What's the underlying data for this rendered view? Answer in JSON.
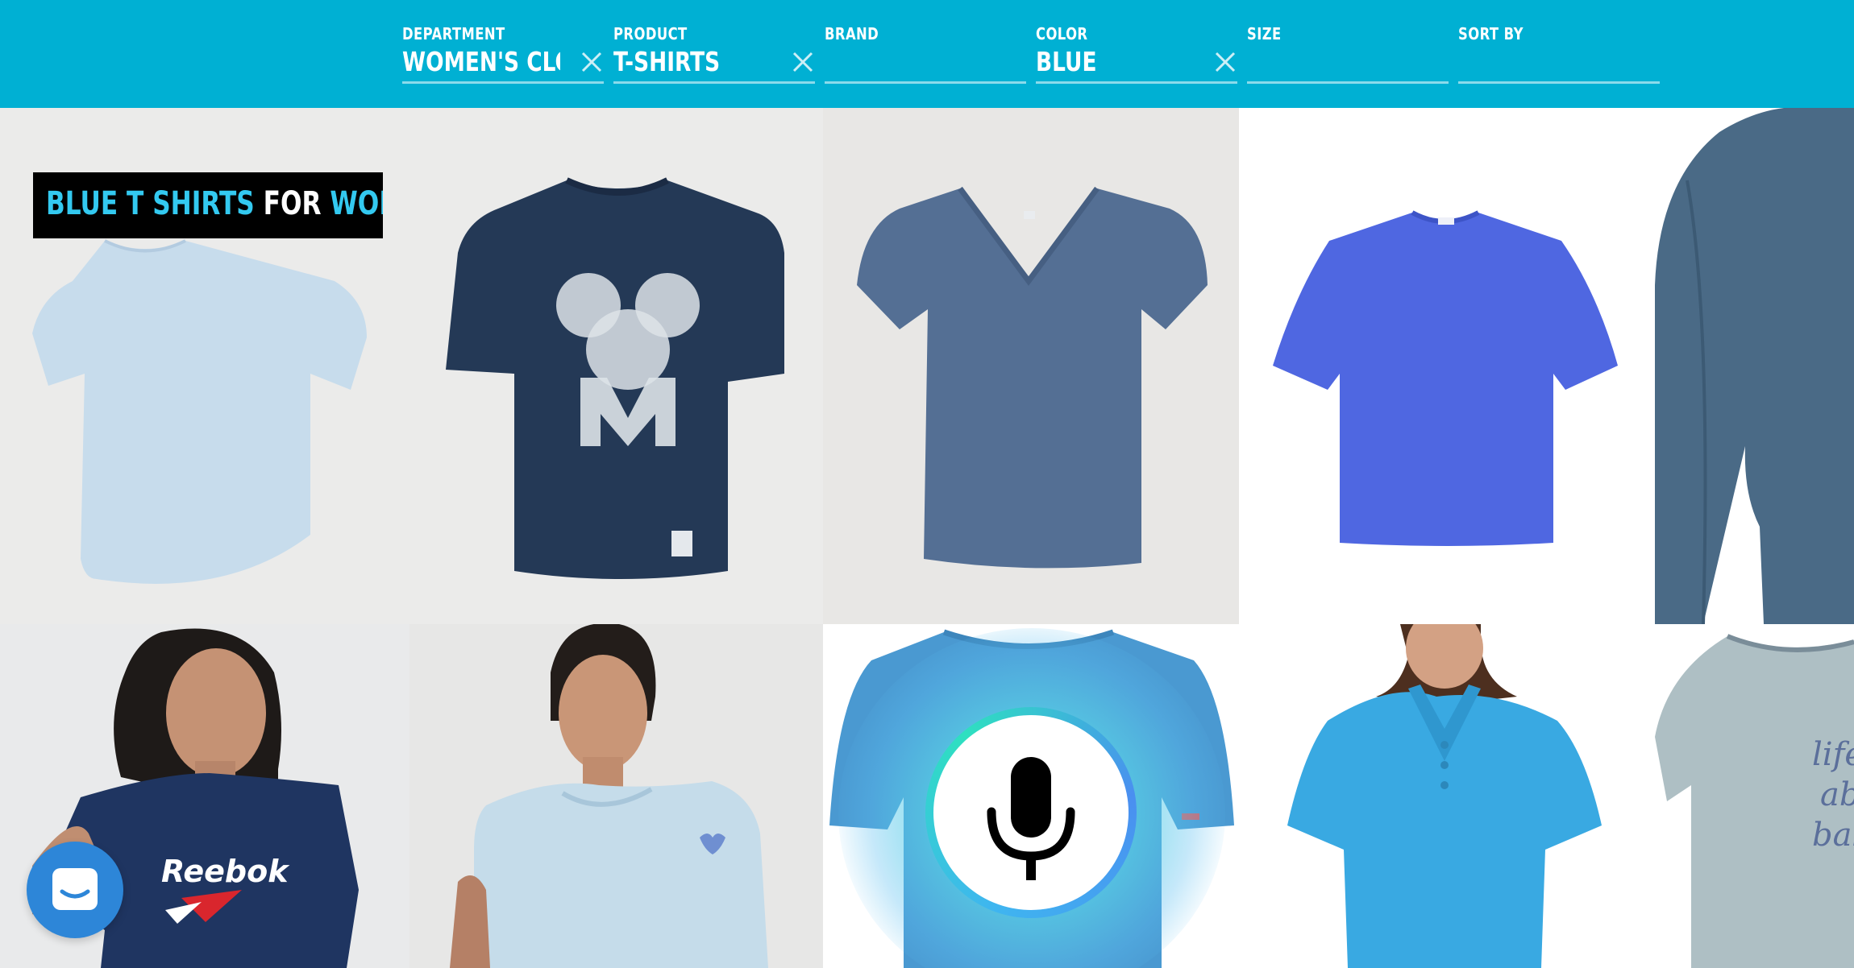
{
  "filters": [
    {
      "key": "department",
      "label": "DEPARTMENT",
      "value": "WOMEN'S CLOT",
      "clearable": true
    },
    {
      "key": "product",
      "label": "PRODUCT",
      "value": "T-SHIRTS",
      "clearable": true
    },
    {
      "key": "brand",
      "label": "BRAND",
      "value": "",
      "clearable": false
    },
    {
      "key": "color",
      "label": "COLOR",
      "value": "BLUE",
      "clearable": true
    },
    {
      "key": "size",
      "label": "SIZE",
      "value": "",
      "clearable": false
    },
    {
      "key": "sort",
      "label": "SORT BY",
      "value": "",
      "clearable": false
    }
  ],
  "title_badge": {
    "part1": "BLUE T SHIRTS",
    "part2": "FOR",
    "part3": "WOMEN"
  },
  "products": {
    "p1_logo": "Reebok",
    "p5_print": [
      "life",
      "ab",
      "bal"
    ]
  },
  "colors": {
    "header_bg": "#00b0d3",
    "title_accent": "#33c9f0",
    "chat_button": "#2d86d8"
  },
  "icons": {
    "clear": "close-icon",
    "mic": "microphone-icon",
    "chat": "chat-icon"
  }
}
